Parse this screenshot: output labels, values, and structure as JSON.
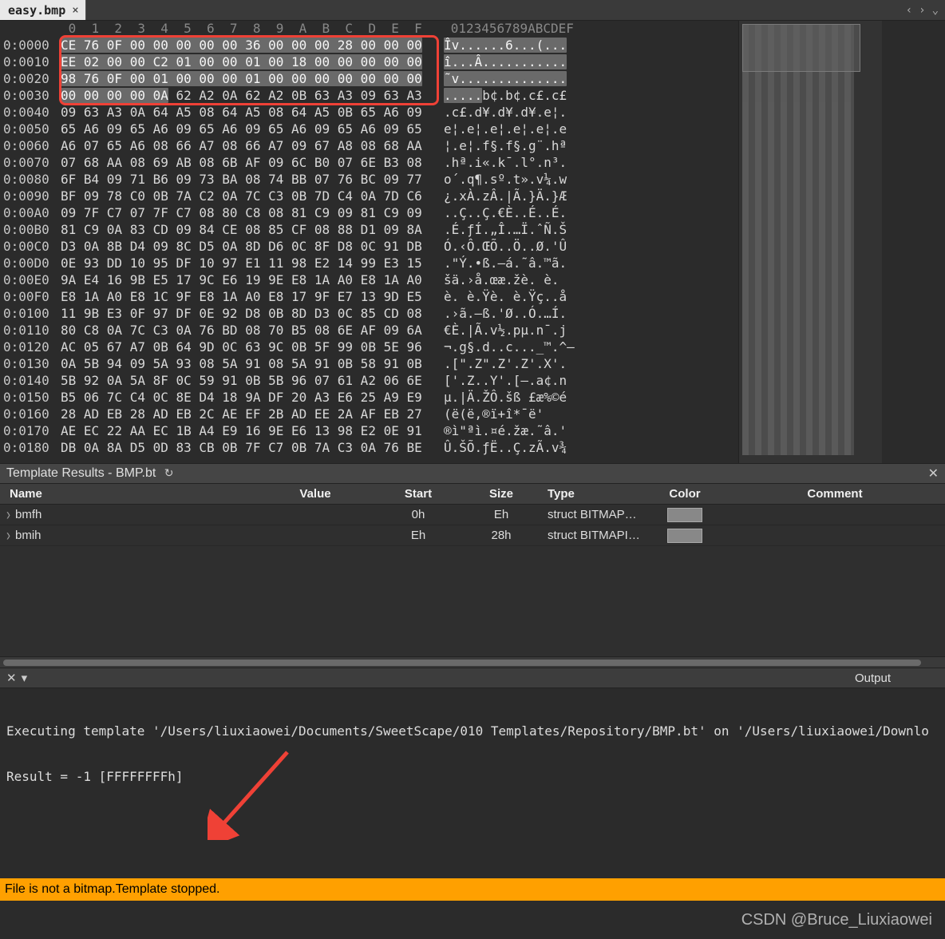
{
  "tab": {
    "title": "easy.bmp",
    "close": "×"
  },
  "nav": {
    "prev": "‹",
    "next": "›",
    "menu": "⌄"
  },
  "hex": {
    "header_cols": "0  1  2  3  4  5  6  7  8  9  A  B  C  D  E  F",
    "ascii_header": "0123456789ABCDEF",
    "rows": [
      {
        "o": "0:0000",
        "b": "CE 76 0F 00 00 00 00 00 36 00 00 00 28 00 00 00",
        "a": "Îv......6...(..."
      },
      {
        "o": "0:0010",
        "b": "EE 02 00 00 C2 01 00 00 01 00 18 00 00 00 00 00",
        "a": "î...Â..........."
      },
      {
        "o": "0:0020",
        "b": "98 76 0F 00 01 00 00 00 01 00 00 00 00 00 00 00",
        "a": "˜v.............."
      },
      {
        "o": "0:0030",
        "b": "00 00 00 00 0A 62 A2 0A 62 A2 0B 63 A3 09 63 A3",
        "a": ".....b¢.b¢.c£.c£"
      },
      {
        "o": "0:0040",
        "b": "09 63 A3 0A 64 A5 08 64 A5 08 64 A5 0B 65 A6 09",
        "a": ".c£.d¥.d¥.d¥.e¦."
      },
      {
        "o": "0:0050",
        "b": "65 A6 09 65 A6 09 65 A6 09 65 A6 09 65 A6 09 65",
        "a": "e¦.e¦.e¦.e¦.e¦.e"
      },
      {
        "o": "0:0060",
        "b": "A6 07 65 A6 08 66 A7 08 66 A7 09 67 A8 08 68 AA",
        "a": "¦.e¦.f§.f§.g¨.hª"
      },
      {
        "o": "0:0070",
        "b": "07 68 AA 08 69 AB 08 6B AF 09 6C B0 07 6E B3 08",
        "a": ".hª.i«.k¯.l°.n³."
      },
      {
        "o": "0:0080",
        "b": "6F B4 09 71 B6 09 73 BA 08 74 BB 07 76 BC 09 77",
        "a": "o´.q¶.sº.t».v¼.w"
      },
      {
        "o": "0:0090",
        "b": "BF 09 78 C0 0B 7A C2 0A 7C C3 0B 7D C4 0A 7D C6",
        "a": "¿.xÀ.zÂ.|Ã.}Ä.}Æ"
      },
      {
        "o": "0:00A0",
        "b": "09 7F C7 07 7F C7 08 80 C8 08 81 C9 09 81 C9 09",
        "a": "..Ç..Ç.€È..É..É."
      },
      {
        "o": "0:00B0",
        "b": "81 C9 0A 83 CD 09 84 CE 08 85 CF 08 88 D1 09 8A",
        "a": ".É.ƒÍ.„Î.…Ï.ˆÑ.Š"
      },
      {
        "o": "0:00C0",
        "b": "D3 0A 8B D4 09 8C D5 0A 8D D6 0C 8F D8 0C 91 DB",
        "a": "Ó.‹Ô.ŒÕ..Ö..Ø.'Û"
      },
      {
        "o": "0:00D0",
        "b": "0E 93 DD 10 95 DF 10 97 E1 11 98 E2 14 99 E3 15",
        "a": ".\"Ý.•ß.—á.˜â.™ã."
      },
      {
        "o": "0:00E0",
        "b": "9A E4 16 9B E5 17 9C E6 19 9E E8 1A A0 E8 1A A0",
        "a": "šä.›å.œæ.žè. è. "
      },
      {
        "o": "0:00F0",
        "b": "E8 1A A0 E8 1C 9F E8 1A A0 E8 17 9F E7 13 9D E5",
        "a": "è. è.Ÿè. è.Ÿç..å"
      },
      {
        "o": "0:0100",
        "b": "11 9B E3 0F 97 DF 0E 92 D8 0B 8D D3 0C 85 CD 08",
        "a": ".›ã.—ß.'Ø..Ó.…Í."
      },
      {
        "o": "0:0110",
        "b": "80 C8 0A 7C C3 0A 76 BD 08 70 B5 08 6E AF 09 6A",
        "a": "€È.|Ã.v½.pµ.n¯.j"
      },
      {
        "o": "0:0120",
        "b": "AC 05 67 A7 0B 64 9D 0C 63 9C 0B 5F 99 0B 5E 96",
        "a": "¬.g§.d..c..._™.^–"
      },
      {
        "o": "0:0130",
        "b": "0A 5B 94 09 5A 93 08 5A 91 08 5A 91 0B 58 91 0B",
        "a": ".[\".Z\".Z'.Z'.X'."
      },
      {
        "o": "0:0140",
        "b": "5B 92 0A 5A 8F 0C 59 91 0B 5B 96 07 61 A2 06 6E",
        "a": "['.Z..Y'.[–.a¢.n"
      },
      {
        "o": "0:0150",
        "b": "B5 06 7C C4 0C 8E D4 18 9A DF 20 A3 E6 25 A9 E9",
        "a": "µ.|Ä.ŽÔ.šß £æ%©é"
      },
      {
        "o": "0:0160",
        "b": "28 AD EB 28 AD EB 2C AE EF 2B AD EE 2A AF EB 27",
        "a": "(­ë(­ë,®ï+­î*¯ë'"
      },
      {
        "o": "0:0170",
        "b": "AE EC 22 AA EC 1B A4 E9 16 9E E6 13 98 E2 0E 91",
        "a": "®ì\"ªì.¤é.žæ.˜â.'"
      },
      {
        "o": "0:0180",
        "b": "DB 0A 8A D5 0D 83 CB 0B 7F C7 0B 7A C3 0A 76 BE",
        "a": "Û.ŠÕ.ƒË..Ç.zÃ.v¾"
      }
    ]
  },
  "results": {
    "title": "Template Results - BMP.bt",
    "cols": [
      "Name",
      "Value",
      "Start",
      "Size",
      "Type",
      "Color",
      "Comment"
    ],
    "rows": [
      {
        "name": "bmfh",
        "value": "",
        "start": "0h",
        "size": "Eh",
        "type": "struct BITMAP…"
      },
      {
        "name": "bmih",
        "value": "",
        "start": "Eh",
        "size": "28h",
        "type": "struct BITMAPI…"
      }
    ]
  },
  "output": {
    "title": "Output",
    "lines": [
      "Executing template '/Users/liuxiaowei/Documents/SweetScape/010 Templates/Repository/BMP.bt' on '/Users/liuxiaowei/Downlo",
      "Result = -1 [FFFFFFFFh]"
    ]
  },
  "status": {
    "text": "File is not a bitmap.Template stopped."
  },
  "watermark": "CSDN @Bruce_Liuxiaowei"
}
